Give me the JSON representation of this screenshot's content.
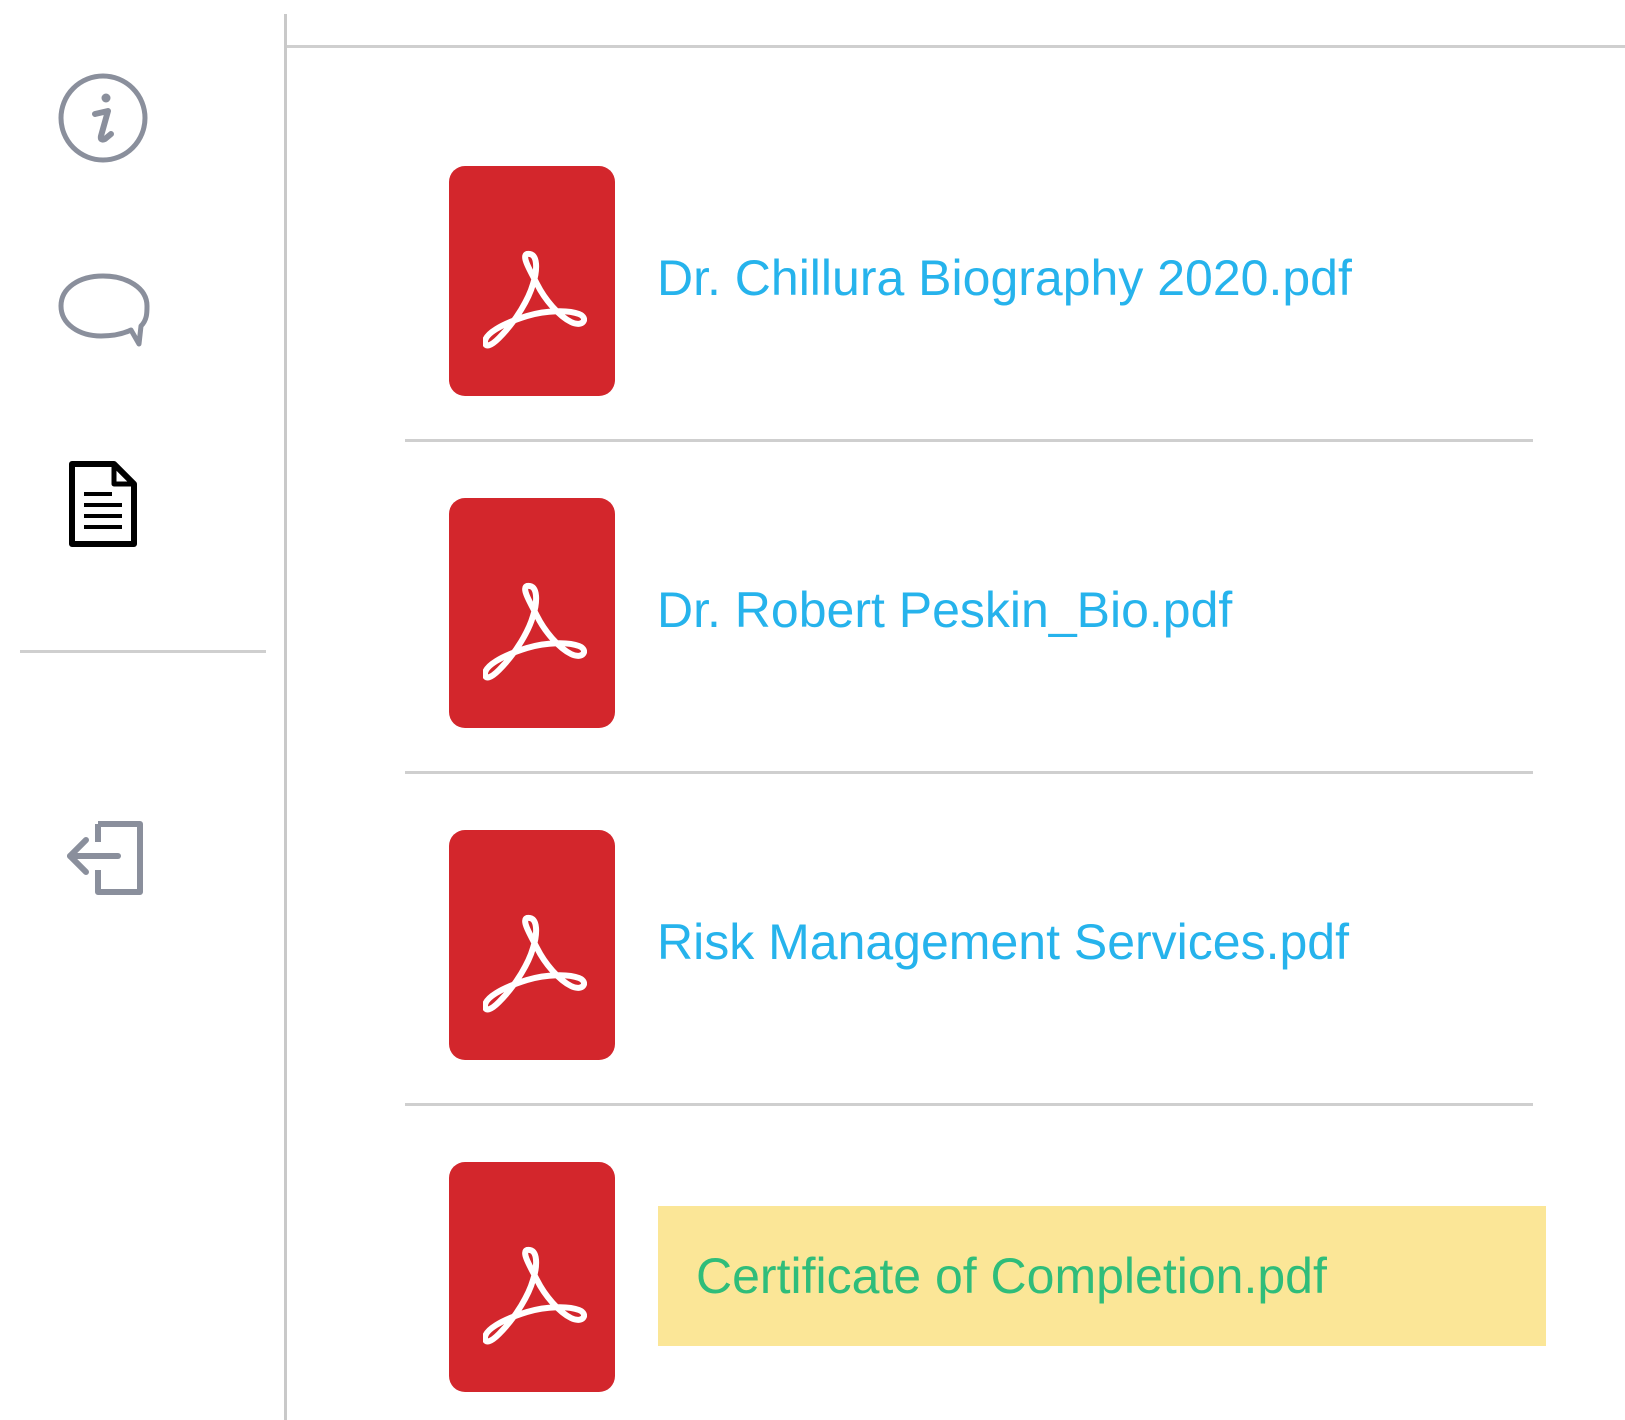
{
  "sidebar": {
    "items": [
      {
        "icon": "info-icon",
        "name": "info"
      },
      {
        "icon": "chat-icon",
        "name": "comments"
      },
      {
        "icon": "document-icon",
        "name": "documents",
        "active": true
      },
      {
        "icon": "logout-icon",
        "name": "logout"
      }
    ]
  },
  "documents": {
    "files": [
      {
        "name": "Dr. Chillura Biography 2020.pdf",
        "highlighted": false
      },
      {
        "name": "Dr. Robert Peskin_Bio.pdf",
        "highlighted": false
      },
      {
        "name": "Risk Management Services.pdf",
        "highlighted": false
      },
      {
        "name": "Certificate of Completion.pdf",
        "highlighted": true
      }
    ]
  },
  "colors": {
    "pdf_icon_bg": "#d3262c",
    "link_text": "#26b3ec",
    "highlight_bg": "#fbe697",
    "highlight_text": "#2fbd7a",
    "divider": "#cfcfcf"
  }
}
